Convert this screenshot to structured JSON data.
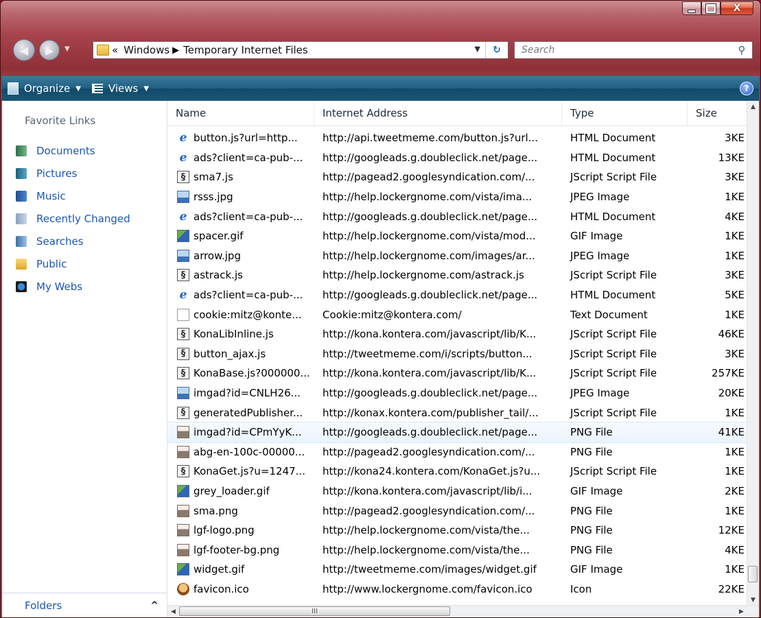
{
  "window": {
    "caption_min": "",
    "caption_max": "",
    "caption_close": "X"
  },
  "address": {
    "overflow": "«",
    "crumbs": [
      "Windows",
      "Temporary Internet Files"
    ],
    "separator": "▶"
  },
  "search": {
    "placeholder": "Search"
  },
  "toolbar": {
    "organize": "Organize",
    "views": "Views",
    "help": "?"
  },
  "nav": {
    "favorites_title": "Favorite Links",
    "items": [
      {
        "label": "Documents",
        "icon": "documents-icon"
      },
      {
        "label": "Pictures",
        "icon": "pictures-icon"
      },
      {
        "label": "Music",
        "icon": "music-icon"
      },
      {
        "label": "Recently Changed",
        "icon": "recently-changed-icon"
      },
      {
        "label": "Searches",
        "icon": "searches-icon"
      },
      {
        "label": "Public",
        "icon": "public-folder-icon"
      },
      {
        "label": "My Webs",
        "icon": "my-webs-icon"
      }
    ],
    "folders_label": "Folders"
  },
  "columns": {
    "name": "Name",
    "address": "Internet Address",
    "type": "Type",
    "size": "Size"
  },
  "files": [
    {
      "name": "button.js?url=http...",
      "address": "http://api.tweetmeme.com/button.js?url...",
      "type": "HTML Document",
      "size": "3KE",
      "icon": "html"
    },
    {
      "name": "ads?client=ca-pub-...",
      "address": "http://googleads.g.doubleclick.net/page...",
      "type": "HTML Document",
      "size": "13KE",
      "icon": "html"
    },
    {
      "name": "sma7.js",
      "address": "http://pagead2.googlesyndication.com/...",
      "type": "JScript Script File",
      "size": "3KE",
      "icon": "js"
    },
    {
      "name": "rsss.jpg",
      "address": "http://help.lockergnome.com/vista/ima...",
      "type": "JPEG Image",
      "size": "1KE",
      "icon": "jpeg"
    },
    {
      "name": "ads?client=ca-pub-...",
      "address": "http://googleads.g.doubleclick.net/page...",
      "type": "HTML Document",
      "size": "4KE",
      "icon": "html"
    },
    {
      "name": "spacer.gif",
      "address": "http://help.lockergnome.com/vista/mod...",
      "type": "GIF Image",
      "size": "1KE",
      "icon": "gif"
    },
    {
      "name": "arrow.jpg",
      "address": "http://help.lockergnome.com/images/ar...",
      "type": "JPEG Image",
      "size": "1KE",
      "icon": "jpeg"
    },
    {
      "name": "astrack.js",
      "address": "http://help.lockergnome.com/astrack.js",
      "type": "JScript Script File",
      "size": "3KE",
      "icon": "js"
    },
    {
      "name": "ads?client=ca-pub-...",
      "address": "http://googleads.g.doubleclick.net/page...",
      "type": "HTML Document",
      "size": "5KE",
      "icon": "html"
    },
    {
      "name": "cookie:mitz@konte...",
      "address": "Cookie:mitz@kontera.com/",
      "type": "Text Document",
      "size": "1KE",
      "icon": "text"
    },
    {
      "name": "KonaLibInline.js",
      "address": "http://kona.kontera.com/javascript/lib/K...",
      "type": "JScript Script File",
      "size": "46KE",
      "icon": "js"
    },
    {
      "name": "button_ajax.js",
      "address": "http://tweetmeme.com/i/scripts/button...",
      "type": "JScript Script File",
      "size": "3KE",
      "icon": "js"
    },
    {
      "name": "KonaBase.js?000000...",
      "address": "http://kona.kontera.com/javascript/lib/K...",
      "type": "JScript Script File",
      "size": "257KE",
      "icon": "js"
    },
    {
      "name": "imgad?id=CNLH26...",
      "address": "http://googleads.g.doubleclick.net/page...",
      "type": "JPEG Image",
      "size": "20KE",
      "icon": "jpeg"
    },
    {
      "name": "generatedPublisher...",
      "address": "http://konax.kontera.com/publisher_tail/...",
      "type": "JScript Script File",
      "size": "1KE",
      "icon": "js"
    },
    {
      "name": "imgad?id=CPmYyK...",
      "address": "http://googleads.g.doubleclick.net/page...",
      "type": "PNG File",
      "size": "41KE",
      "icon": "png",
      "hover": true
    },
    {
      "name": "abg-en-100c-00000...",
      "address": "http://pagead2.googlesyndication.com/...",
      "type": "PNG File",
      "size": "1KE",
      "icon": "png"
    },
    {
      "name": "KonaGet.js?u=1247...",
      "address": "http://kona24.kontera.com/KonaGet.js?u...",
      "type": "JScript Script File",
      "size": "1KE",
      "icon": "js"
    },
    {
      "name": "grey_loader.gif",
      "address": "http://kona.kontera.com/javascript/lib/i...",
      "type": "GIF Image",
      "size": "2KE",
      "icon": "gif"
    },
    {
      "name": "sma.png",
      "address": "http://pagead2.googlesyndication.com/...",
      "type": "PNG File",
      "size": "1KE",
      "icon": "png"
    },
    {
      "name": "lgf-logo.png",
      "address": "http://help.lockergnome.com/vista/the...",
      "type": "PNG File",
      "size": "12KE",
      "icon": "png"
    },
    {
      "name": "lgf-footer-bg.png",
      "address": "http://help.lockergnome.com/vista/the...",
      "type": "PNG File",
      "size": "4KE",
      "icon": "png"
    },
    {
      "name": "widget.gif",
      "address": "http://tweetmeme.com/images/widget.gif",
      "type": "GIF Image",
      "size": "1KE",
      "icon": "gif"
    },
    {
      "name": "favicon.ico",
      "address": "http://www.lockergnome.com/favicon.ico",
      "type": "Icon",
      "size": "22KE",
      "icon": "ico"
    }
  ],
  "hscroll_grip": "III"
}
